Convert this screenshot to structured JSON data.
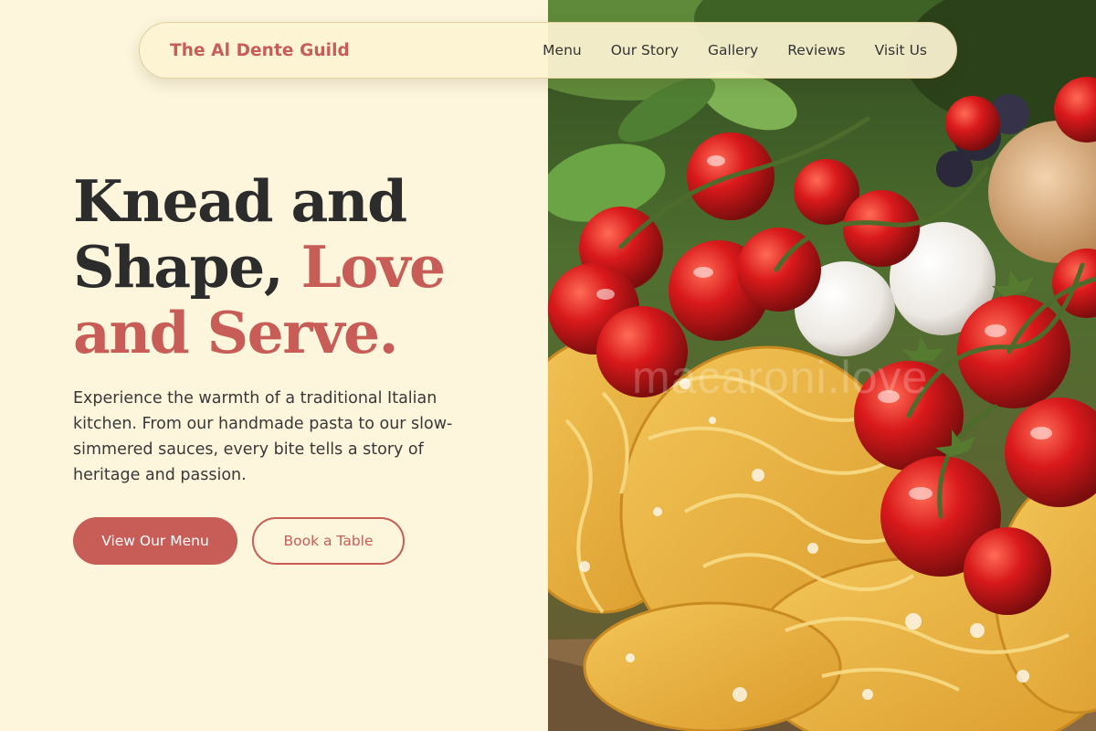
{
  "header": {
    "brand": "The Al Dente Guild",
    "nav": [
      {
        "label": "Menu"
      },
      {
        "label": "Our Story"
      },
      {
        "label": "Gallery"
      },
      {
        "label": "Reviews"
      },
      {
        "label": "Visit Us"
      }
    ]
  },
  "hero": {
    "headline_part1": "Knead and Shape, ",
    "headline_accent": "Love and Serve.",
    "body": "Experience the warmth of a traditional Italian kitchen. From our handmade pasta to our slow-simmered sauces, every bite tells a story of heritage and passion.",
    "primary_button": "View Our Menu",
    "secondary_button": "Book a Table"
  },
  "image": {
    "subject": "fresh-pasta-tomatoes-eggs-photo",
    "watermark": "macaroni.love"
  },
  "colors": {
    "background": "#fdf6dc",
    "accent": "#c85d57",
    "text": "#2c2c2c"
  }
}
